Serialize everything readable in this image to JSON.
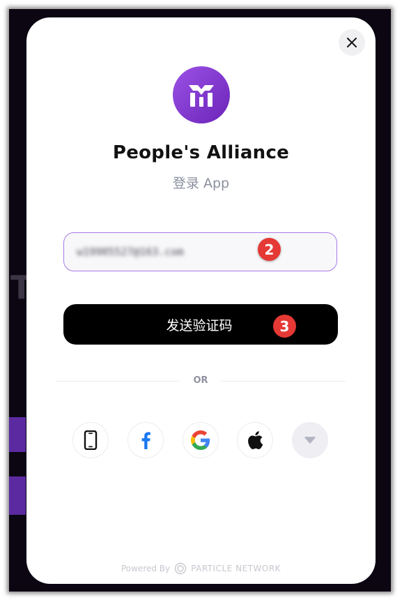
{
  "app": {
    "name": "People's Alliance",
    "subtitle": "登录 App",
    "accent": "#7b35cc"
  },
  "login": {
    "email_value": "w19905527@163.com",
    "send_code_label": "发送验证码",
    "or_label": "OR"
  },
  "social_buttons": [
    {
      "name": "phone",
      "icon": "phone-icon"
    },
    {
      "name": "facebook",
      "icon": "facebook-icon"
    },
    {
      "name": "google",
      "icon": "google-icon"
    },
    {
      "name": "apple",
      "icon": "apple-icon"
    },
    {
      "name": "more",
      "icon": "chevron-down-icon"
    }
  ],
  "annotations": {
    "step_email": "2",
    "step_send": "3"
  },
  "footer": {
    "powered_by": "Powered By",
    "network": "PARTICLE NETWORK"
  }
}
